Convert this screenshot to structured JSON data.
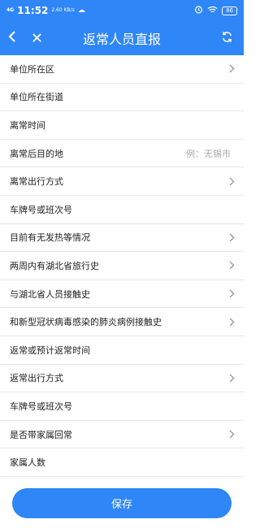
{
  "status_bar": {
    "network": "4G",
    "time": "11:52",
    "speed": "2.60 KB/s",
    "battery": "86",
    "icons": [
      "cloud-icon",
      "alarm-icon",
      "wifi-icon",
      "battery-icon"
    ]
  },
  "header": {
    "title": "返常人员直报",
    "icons": [
      "back-icon",
      "close-icon",
      "refresh-icon"
    ]
  },
  "form": {
    "rows": [
      {
        "label": "单位所在区",
        "placeholder": "",
        "chevron": true
      },
      {
        "label": "单位所在街道",
        "placeholder": "",
        "chevron": false
      },
      {
        "label": "离常时间",
        "placeholder": "",
        "chevron": false
      },
      {
        "label": "离常后目的地",
        "placeholder": "例：无锡市",
        "chevron": false
      },
      {
        "label": "离常出行方式",
        "placeholder": "",
        "chevron": true
      },
      {
        "label": "车牌号或班次号",
        "placeholder": "",
        "chevron": false
      },
      {
        "label": "目前有无发热等情况",
        "placeholder": "",
        "chevron": true
      },
      {
        "label": "两周内有湖北省旅行史",
        "placeholder": "",
        "chevron": true
      },
      {
        "label": "与湖北省人员接触史",
        "placeholder": "",
        "chevron": true
      },
      {
        "label": "和新型冠状病毒感染的肺炎病例接触史",
        "placeholder": "",
        "chevron": true
      },
      {
        "label": "返常或预计返常时间",
        "placeholder": "",
        "chevron": false
      },
      {
        "label": "返常出行方式",
        "placeholder": "",
        "chevron": true
      },
      {
        "label": "车牌号或班次号",
        "placeholder": "",
        "chevron": false
      },
      {
        "label": "是否带家属回常",
        "placeholder": "",
        "chevron": true
      },
      {
        "label": "家属人数",
        "placeholder": "",
        "chevron": false
      }
    ]
  },
  "footer": {
    "save_label": "保存"
  },
  "colors": {
    "primary": "#2f86f6",
    "divider": "#e6e6e6",
    "placeholder": "#a8a8a8",
    "chevron": "#9a9a9a"
  }
}
